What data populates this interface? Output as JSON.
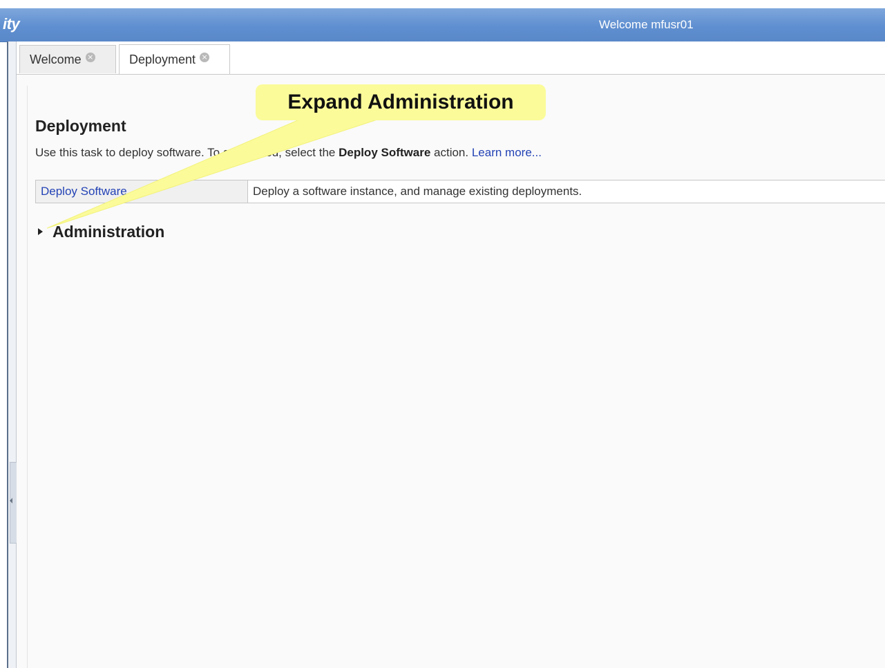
{
  "header": {
    "brand_fragment": "ity",
    "welcome_user": "Welcome mfusr01"
  },
  "tabs": [
    {
      "label": "Welcome",
      "active": false
    },
    {
      "label": "Deployment",
      "active": true
    }
  ],
  "icons": {
    "tab_close": "close-circle-icon",
    "section_collapsed": "triangle-right-icon",
    "panel_collapse": "chevron-left-icon"
  },
  "main": {
    "title": "Deployment",
    "description": {
      "prefix": "Use this task to deploy software",
      "middle": ". To get started, select the ",
      "bold": "Deploy Software",
      "suffix": " action. ",
      "link": "Learn more..."
    },
    "tasks": [
      {
        "link": "Deploy Software",
        "description": "Deploy a software instance, and manage existing deployments."
      }
    ],
    "section": {
      "label": "Administration",
      "expanded": false
    }
  },
  "callout": {
    "text": "Expand Administration",
    "color": "#fbfb9a"
  },
  "colors": {
    "header": "#5f8fd0",
    "link": "#2443b5"
  }
}
